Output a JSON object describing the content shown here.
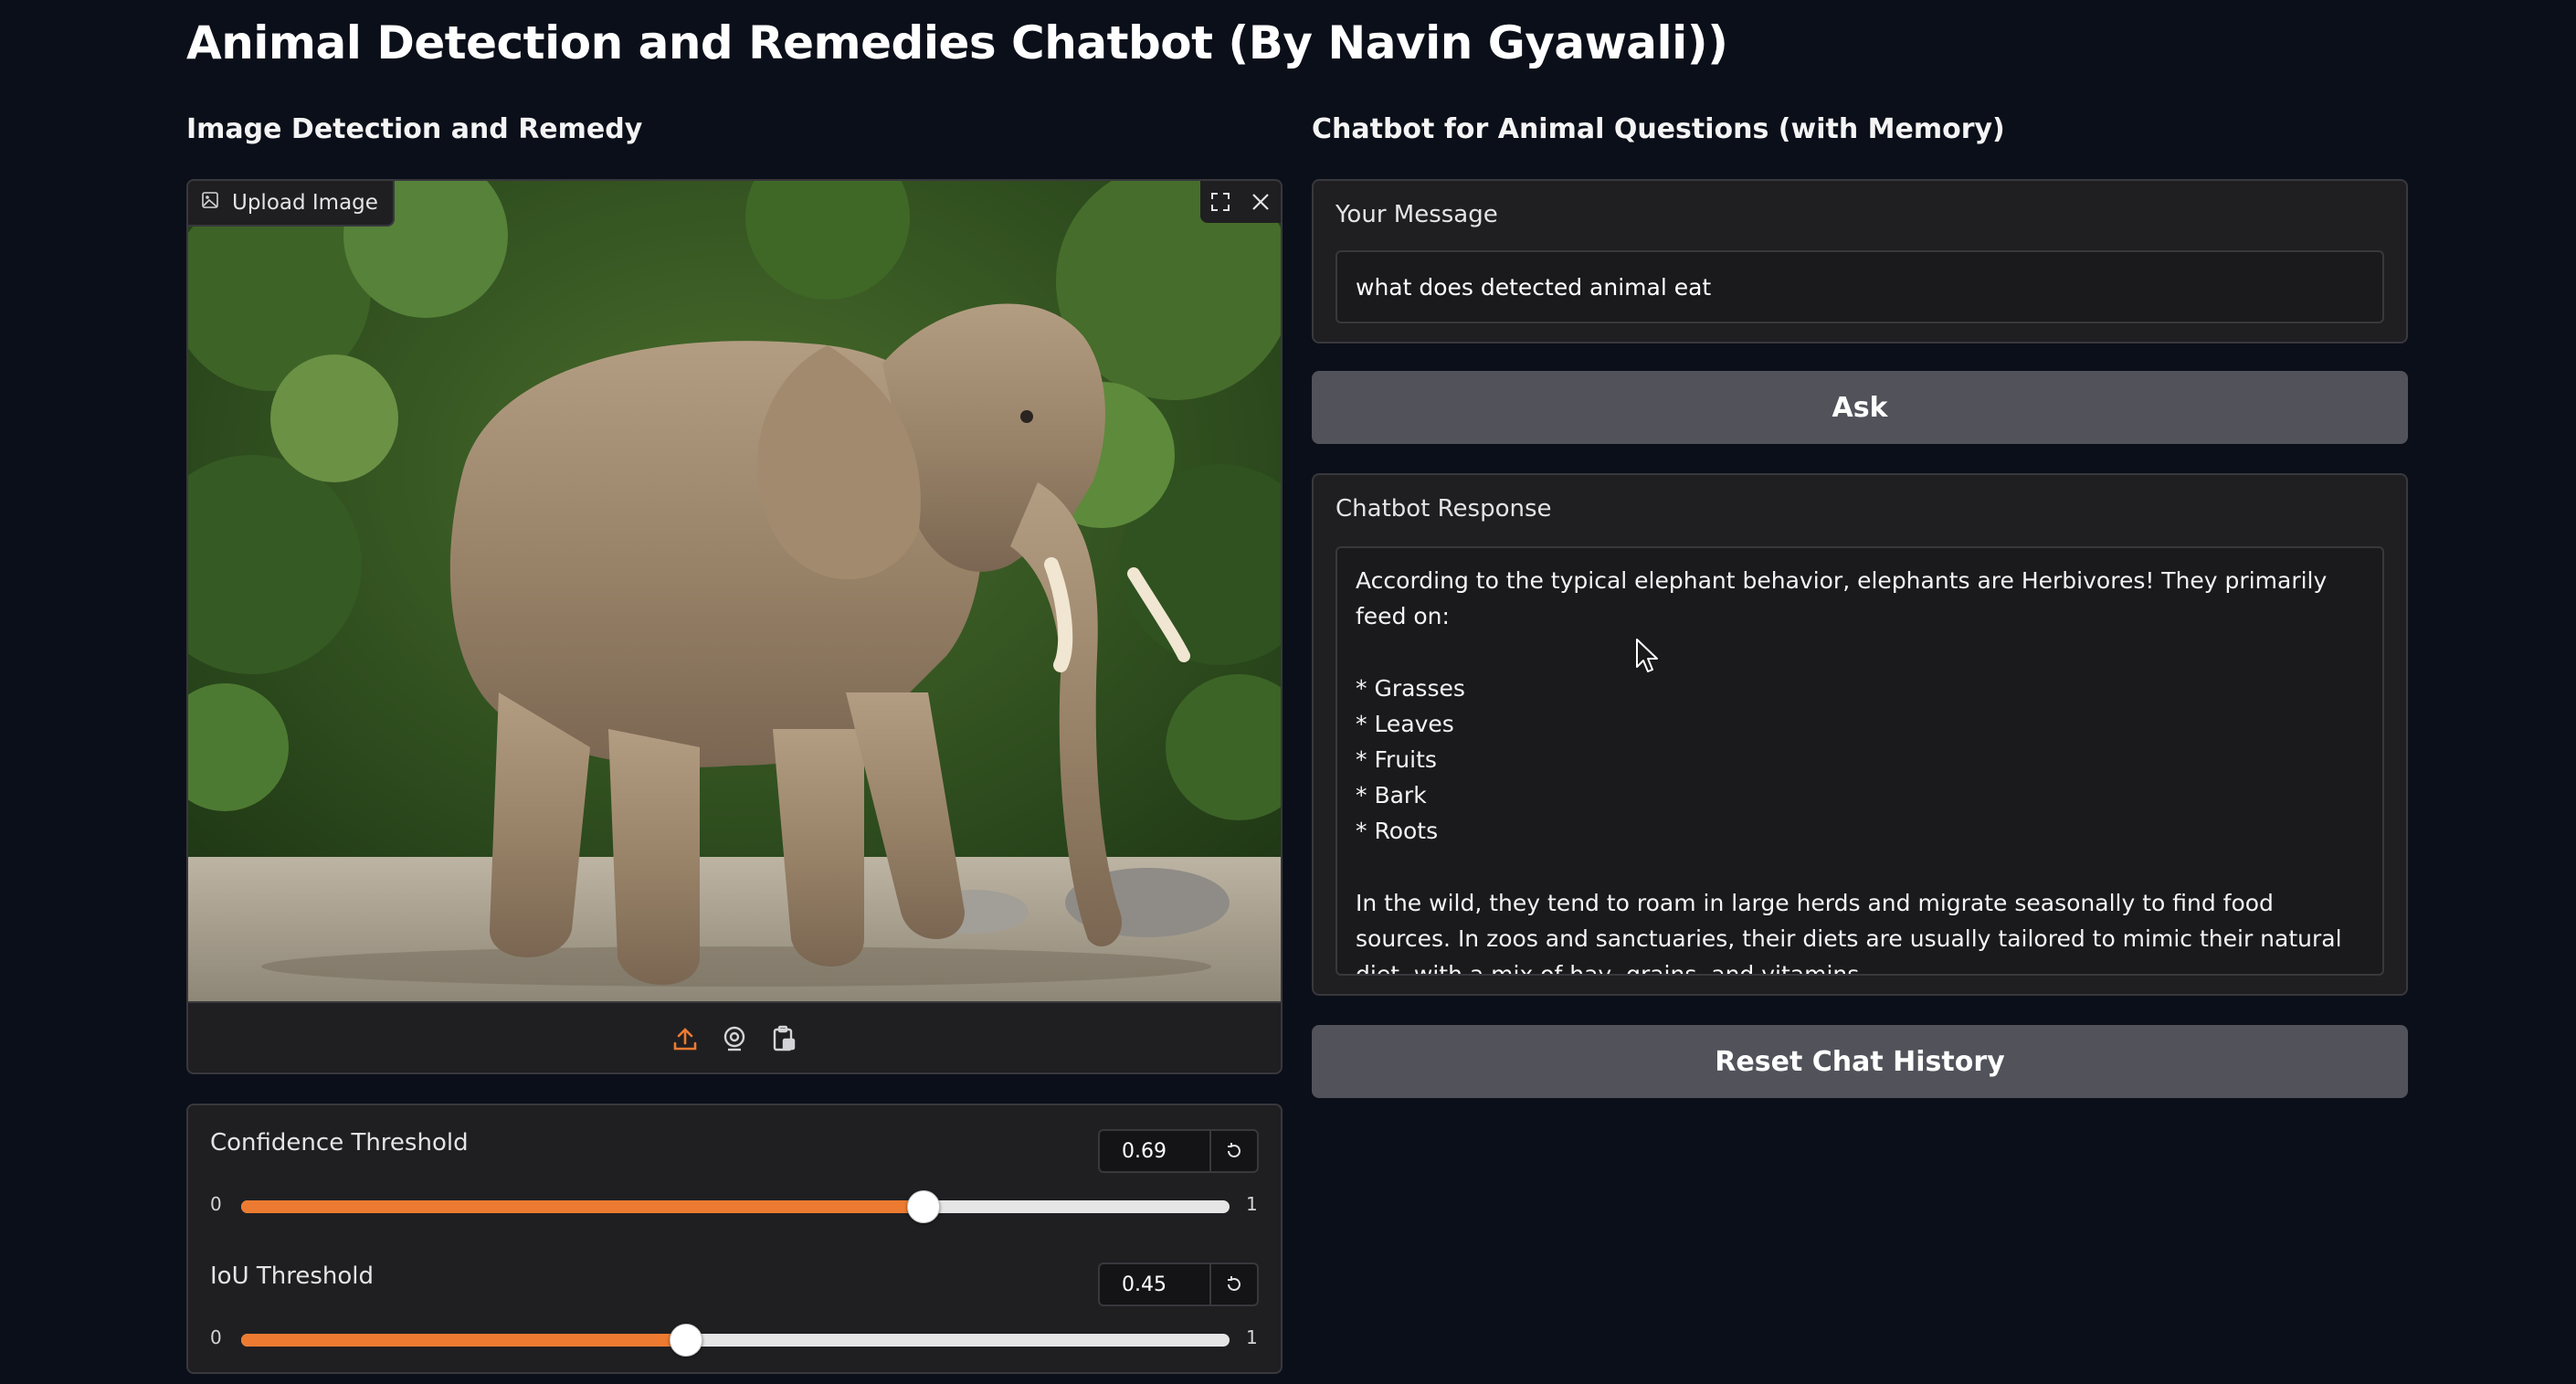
{
  "app": {
    "title": "Animal Detection and Remedies Chatbot (By Navin Gyawali))"
  },
  "colors": {
    "background": "#0b0f19",
    "panel": "#1f1f22",
    "border": "#38383d",
    "accent": "#ec7b31",
    "button": "#52525b"
  },
  "left": {
    "heading": "Image Detection and Remedy",
    "image": {
      "label": "Upload Image",
      "label_icon": "image-icon",
      "subject": "elephant photo",
      "toolbar_icons": [
        "fullscreen-icon",
        "close-icon"
      ],
      "source_icons": [
        "upload-icon",
        "webcam-icon",
        "clipboard-icon"
      ]
    },
    "sliders": [
      {
        "label": "Confidence Threshold",
        "value": "0.69",
        "level": 0.69,
        "min": "0",
        "max": "1"
      },
      {
        "label": "IoU Threshold",
        "value": "0.45",
        "level": 0.45,
        "min": "0",
        "max": "1"
      }
    ]
  },
  "right": {
    "heading": "Chatbot for Animal Questions (with Memory)",
    "message": {
      "label": "Your Message",
      "value": "what does detected animal eat"
    },
    "ask_label": "Ask",
    "response": {
      "label": "Chatbot Response",
      "text": "According to the typical elephant behavior, elephants are Herbivores! They primarily feed on:\n\n* Grasses\n* Leaves\n* Fruits\n* Bark\n* Roots\n\nIn the wild, they tend to roam in large herds and migrate seasonally to find food sources. In zoos and sanctuaries, their diets are usually tailored to mimic their natural diet, with a mix of hay, grains, and vitamins."
    },
    "reset_label": "Reset Chat History"
  }
}
